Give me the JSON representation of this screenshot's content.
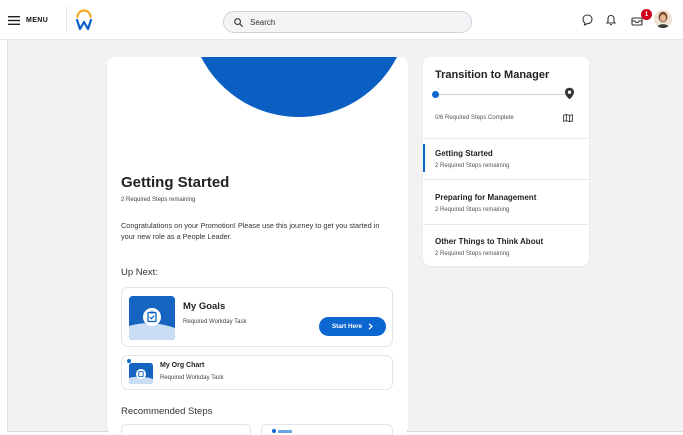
{
  "topbar": {
    "menu_label": "MENU",
    "search_placeholder": "Search",
    "notification_count": "1"
  },
  "journey": {
    "title": "Getting Started",
    "subtitle": "2 Required Steps remaining",
    "description": "Congratulations on your Promotion! Please use this journey to get you started in your new role as a People Leader.",
    "up_next_label": "Up Next:",
    "next_task": {
      "title": "My Goals",
      "type": "Required Workday Task",
      "button_label": "Start Here"
    },
    "org_task": {
      "title": "My Org Chart",
      "type": "Required Workday Task"
    },
    "recommended_label": "Recommended Steps"
  },
  "sidebar": {
    "title": "Transition to Manager",
    "progress_text": "0/6 Required Steps Complete",
    "progress_fraction": 0,
    "items": [
      {
        "title": "Getting Started",
        "subtitle": "2 Required Steps remaining",
        "active": true
      },
      {
        "title": "Preparing for Management",
        "subtitle": "2 Required Steps remaining",
        "active": false
      },
      {
        "title": "Other Things to Think About",
        "subtitle": "2 Required Steps remaining",
        "active": false
      }
    ]
  },
  "colors": {
    "accent": "#0b66d0",
    "hero_blue": "#0b5fc2",
    "logo_orange": "#f5a623",
    "badge_red": "#d0021b",
    "background": "#f2f2f3"
  },
  "icons": [
    "menu-icon",
    "workday-logo",
    "search-icon",
    "chat-icon",
    "bell-icon",
    "inbox-icon",
    "map-icon",
    "chevron-right-icon",
    "goals-icon",
    "org-chart-icon"
  ]
}
